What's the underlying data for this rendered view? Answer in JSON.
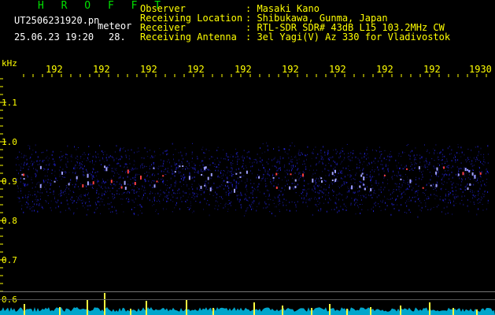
{
  "header": {
    "title": "H R O F F T",
    "filename": "UT2506231920.pn",
    "tag": "meteor",
    "datetime": "25.06.23 19:20",
    "count": "28.",
    "rows": [
      {
        "label": "Observer",
        "value": ": Masaki Kano"
      },
      {
        "label": "Receiving Location",
        "value": ": Shibukawa, Gunma, Japan"
      },
      {
        "label": "Receiver",
        "value": ": RTL-SDR SDR# 43dB L15 103.2MHz CW"
      },
      {
        "label": "Receiving Antenna",
        "value": ": 3el Yagi(V) Az 330 for Vladivostok"
      }
    ]
  },
  "axis": {
    "y_unit": "kHz",
    "y_ticks": [
      "1.1",
      "1.0",
      "0.9",
      "0.8",
      "0.7",
      "0.6"
    ],
    "x_ticks": [
      "192",
      "192",
      "192",
      "192",
      "192",
      "192",
      "192",
      "192",
      "192",
      "1930"
    ]
  },
  "colors": {
    "text": "#ffff00",
    "title": "#00e000",
    "signal": "#2a2aff",
    "hot": "#ff4040",
    "bars": "#ffff40",
    "noise": "#00d0ff"
  }
}
